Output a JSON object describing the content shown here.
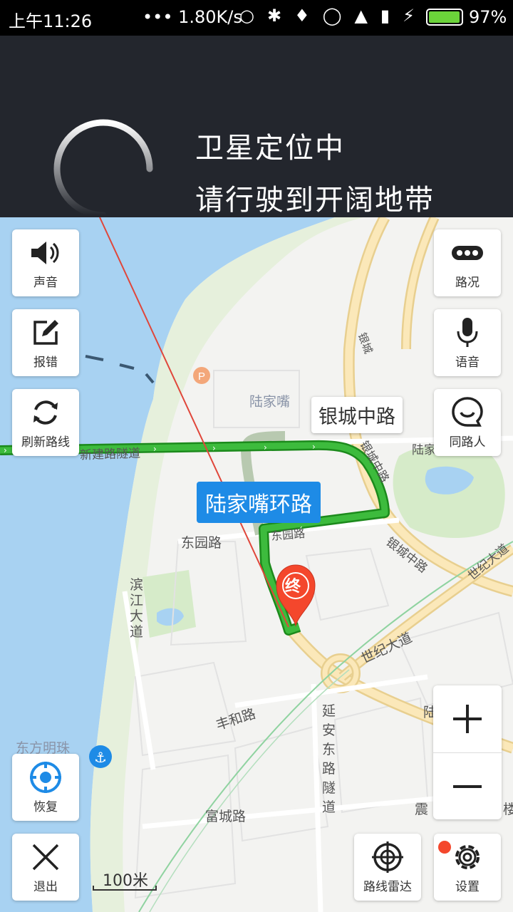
{
  "status_bar": {
    "time": "上午11:26",
    "network_speed": "••• 1.80K/s",
    "battery_percent": "97%",
    "battery_level": 0.97
  },
  "gps_banner": {
    "line1": "卫星定位中",
    "line2": "请行驶到开阔地带"
  },
  "left_buttons": {
    "sound": "声音",
    "report": "报错",
    "refresh": "刷新路线",
    "restore": "恢复",
    "exit": "退出"
  },
  "right_buttons": {
    "traffic": "路况",
    "voice": "语音",
    "fellow": "同路人",
    "radar": "路线雷达",
    "settings": "设置"
  },
  "zoom": {
    "in": "+",
    "out": "−"
  },
  "map_labels": {
    "yincheng_zhonglu_tag": "银城中路",
    "lujiazui_ring_tag": "陆家嘴环路",
    "end_marker": "终",
    "lujiazui": "陆家嘴",
    "xinjian_tunnel": "新建路隧道",
    "dongyuan1": "东园路",
    "dongyuan2": "东园路",
    "binjiang": "滨江大道",
    "yincheng1": "银城中路",
    "yincheng2": "银城中路",
    "yincheng3": "银城中路",
    "shiji1": "世纪大道",
    "shiji2": "世纪大道",
    "fenghe": "丰和路",
    "yanan": "延安东路隧道",
    "fucheng": "富城路",
    "oriental_pearl": "东方明珠",
    "lujia_right": "陆家",
    "zhen": "震",
    "lu_right": "陆",
    "lou": "楼",
    "road_top": "银城",
    "scale": "100米"
  },
  "colors": {
    "route": "#3dbb3d",
    "water": "#a8d2f2",
    "banner": "#23262d",
    "blue_tag": "#1e8be6",
    "end_marker": "#f4472c"
  }
}
